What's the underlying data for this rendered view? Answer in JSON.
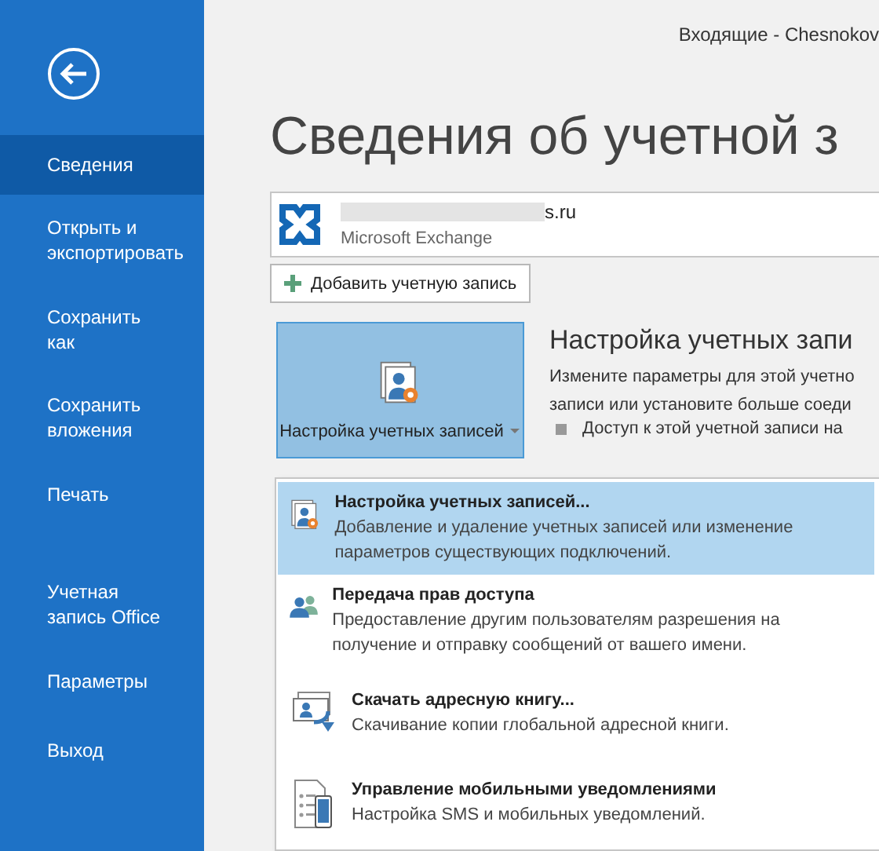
{
  "window": {
    "title": "Входящие - Chesnokov"
  },
  "sidebar": {
    "items": [
      {
        "label": "Сведения",
        "selected": true
      },
      {
        "label": "Открыть и экспортировать",
        "selected": false
      },
      {
        "label": "Сохранить как",
        "selected": false
      },
      {
        "label": "Сохранить вложения",
        "selected": false
      },
      {
        "label": "Печать",
        "selected": false
      },
      {
        "label": "Учетная запись Office",
        "selected": false
      },
      {
        "label": "Параметры",
        "selected": false
      },
      {
        "label": "Выход",
        "selected": false
      }
    ]
  },
  "page": {
    "heading": "Сведения об учетной з",
    "account": {
      "email": "s.ru",
      "type": "Microsoft Exchange"
    },
    "add_account_button": "Добавить учетную запись",
    "account_settings_button": {
      "label": "Настройка учетных записей"
    },
    "section": {
      "title": "Настройка учетных запи",
      "description": "Измените параметры для этой учетно записи или установите больше соеди",
      "bullet": "Доступ к этой учетной записи на"
    }
  },
  "menu": {
    "items": [
      {
        "kind": "settings",
        "title": "Настройка учетных записей...",
        "description": "Добавление и удаление учетных записей или изменение параметров существующих подключений.",
        "selected": true
      },
      {
        "kind": "delegate",
        "title": "Передача прав доступа",
        "description": "Предоставление другим пользователям разрешения на получение и отправку сообщений от вашего имени.",
        "selected": false
      },
      {
        "kind": "addressbook",
        "title": "Скачать адресную книгу...",
        "description": "Скачивание копии глобальной адресной книги.",
        "selected": false
      },
      {
        "kind": "mobile",
        "title": "Управление мобильными уведомлениями",
        "description": "Настройка SMS и мобильных уведомлений.",
        "selected": false
      }
    ]
  }
}
